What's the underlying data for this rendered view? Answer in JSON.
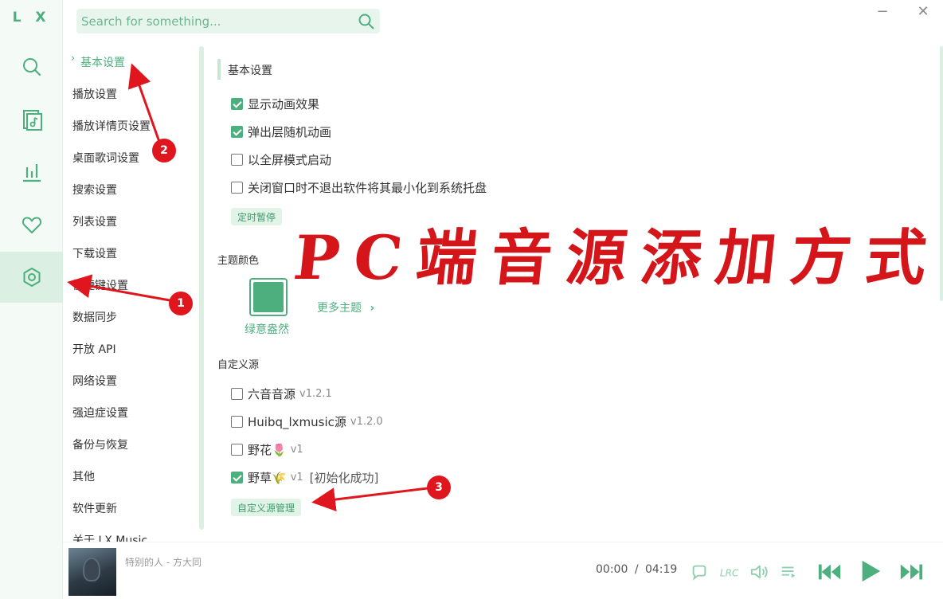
{
  "app": {
    "logo": "L X"
  },
  "search": {
    "placeholder": "Search for something..."
  },
  "window": {
    "minimize": "−",
    "close": "✕"
  },
  "settings_nav": {
    "items": [
      {
        "label": "基本设置",
        "active": true
      },
      {
        "label": "播放设置"
      },
      {
        "label": "播放详情页设置"
      },
      {
        "label": "桌面歌词设置"
      },
      {
        "label": "搜索设置"
      },
      {
        "label": "列表设置"
      },
      {
        "label": "下载设置"
      },
      {
        "label": "快捷键设置"
      },
      {
        "label": "数据同步"
      },
      {
        "label": "开放 API"
      },
      {
        "label": "网络设置"
      },
      {
        "label": "强迫症设置"
      },
      {
        "label": "备份与恢复"
      },
      {
        "label": "其他"
      },
      {
        "label": "软件更新"
      },
      {
        "label": "关于 LX Music"
      }
    ]
  },
  "basic": {
    "title": "基本设置",
    "options": [
      {
        "label": "显示动画效果",
        "checked": true
      },
      {
        "label": "弹出层随机动画",
        "checked": true
      },
      {
        "label": "以全屏模式启动",
        "checked": false
      },
      {
        "label": "关闭窗口时不退出软件将其最小化到系统托盘",
        "checked": false
      }
    ],
    "timer_button": "定时暂停"
  },
  "theme": {
    "title": "主题颜色",
    "current_name": "绿意盎然",
    "current_color": "#4caf7d",
    "more_label": "更多主题"
  },
  "custom_source": {
    "title": "自定义源",
    "sources": [
      {
        "name": "六音音源",
        "version": "v1.2.1",
        "checked": false,
        "status": ""
      },
      {
        "name": "Huibq_lxmusic源",
        "version": "v1.2.0",
        "checked": false,
        "status": ""
      },
      {
        "name": "野花🌷",
        "version": "v1",
        "checked": false,
        "status": ""
      },
      {
        "name": "野草🌾",
        "version": "v1",
        "checked": true,
        "status": "[初始化成功]"
      }
    ],
    "manage_button": "自定义源管理"
  },
  "overlay": {
    "title": "PC端音源添加方式",
    "badges": [
      "1",
      "2",
      "3"
    ],
    "color": "#d4161b"
  },
  "player": {
    "track": "特别的人 - 方大同",
    "current_time": "00:00",
    "separator": "/",
    "duration": "04:19"
  }
}
